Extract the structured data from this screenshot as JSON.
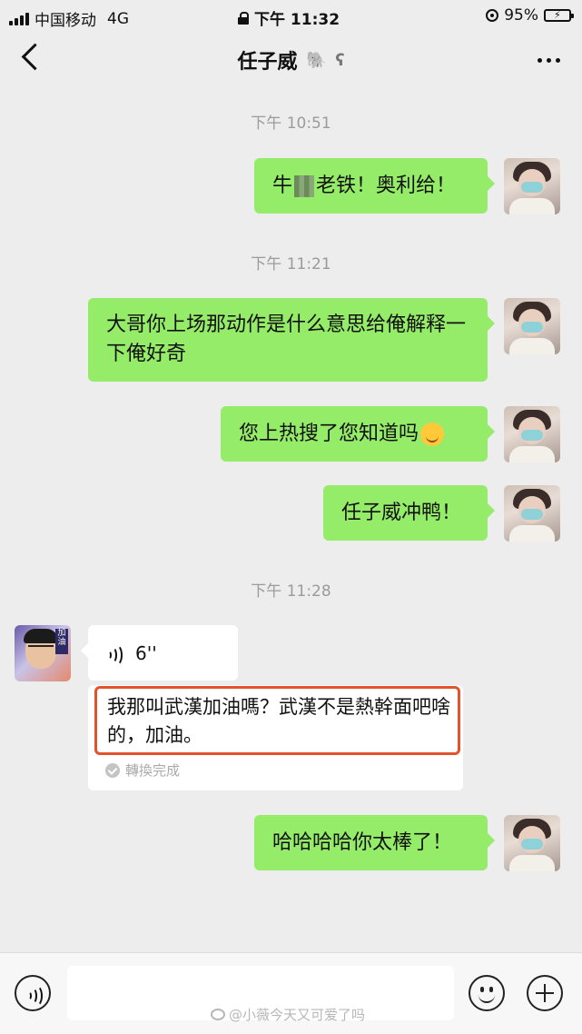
{
  "status_bar": {
    "carrier": "中国移动",
    "network": "4G",
    "time": "下午 11:32",
    "battery_percent": "95%",
    "battery_level": 0.95
  },
  "nav": {
    "title": "任子威",
    "icon_names": [
      "back-icon",
      "elephant-icon",
      "ear-icon",
      "more-icon"
    ]
  },
  "messages": [
    {
      "type": "time",
      "text": "下午 10:51"
    },
    {
      "type": "me",
      "parts": [
        "牛",
        "老铁！奥利给！"
      ]
    },
    {
      "type": "time",
      "text": "下午 11:21"
    },
    {
      "type": "me",
      "text": "大哥你上场那动作是什么意思给俺解释一下俺好奇"
    },
    {
      "type": "me",
      "text": "您上热搜了您知道吗",
      "emoji": "shushing-face-icon"
    },
    {
      "type": "me",
      "text": "任子威冲鸭！"
    },
    {
      "type": "time",
      "text": "下午 11:28"
    },
    {
      "type": "voice",
      "duration": "6''"
    },
    {
      "type": "transcription",
      "text": "我那叫武漢加油嗎？武漢不是熱幹面吧啥的，加油。",
      "status": "轉換完成"
    },
    {
      "type": "me",
      "text": "哈哈哈哈你太棒了！"
    }
  ],
  "watermark": "@小薇今天又可爱了吗",
  "colors": {
    "background": "#ededed",
    "my_bubble": "#95ec69",
    "highlight_border": "#e2532c"
  }
}
